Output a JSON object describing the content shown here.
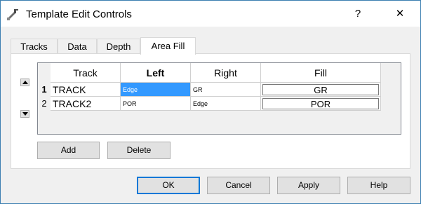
{
  "window": {
    "title": "Template Edit Controls",
    "help_glyph": "?",
    "close_glyph": "✕",
    "app_icon": "tool-icon"
  },
  "tabs": [
    "Tracks",
    "Data",
    "Depth",
    "Area Fill"
  ],
  "active_tab": "Area Fill",
  "grid": {
    "columns": [
      {
        "label": "Track",
        "bold": false
      },
      {
        "label": "Left",
        "bold": true
      },
      {
        "label": "Right",
        "bold": false
      },
      {
        "label": "Fill",
        "bold": false
      }
    ],
    "rows": [
      {
        "number": "1",
        "track": "TRACK",
        "left": "Edge",
        "right": "GR",
        "fill": "GR",
        "selected": true
      },
      {
        "number": "2",
        "track": "TRACK2",
        "left": "POR",
        "right": "Edge",
        "fill": "POR",
        "selected": false
      }
    ]
  },
  "move_up_icon": "triangle-up-icon",
  "move_down_icon": "triangle-down-icon",
  "actions": {
    "add": "Add",
    "delete": "Delete"
  },
  "footer": {
    "ok": "OK",
    "cancel": "Cancel",
    "apply": "Apply",
    "help": "Help"
  }
}
